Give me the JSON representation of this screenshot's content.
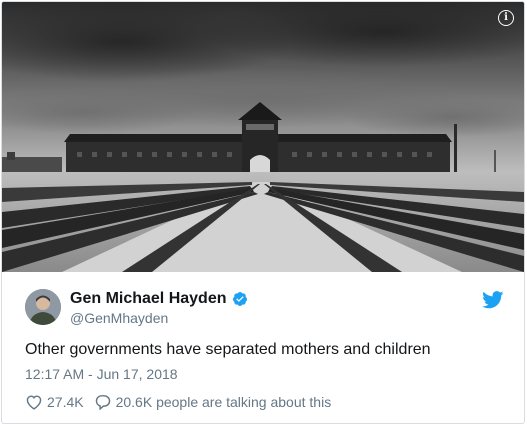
{
  "tweet": {
    "display_name": "Gen Michael Hayden",
    "handle": "@GenMhayden",
    "text": "Other governments have separated mothers and children",
    "timestamp": "12:17 AM - Jun 17, 2018",
    "likes": "27.4K",
    "talking": "20.6K people are talking about this"
  },
  "media": {
    "description_icon": "info-icon"
  },
  "colors": {
    "text": "#14171a",
    "secondary": "#657786",
    "twitter_blue": "#1da1f2",
    "border": "#d7dde2"
  }
}
